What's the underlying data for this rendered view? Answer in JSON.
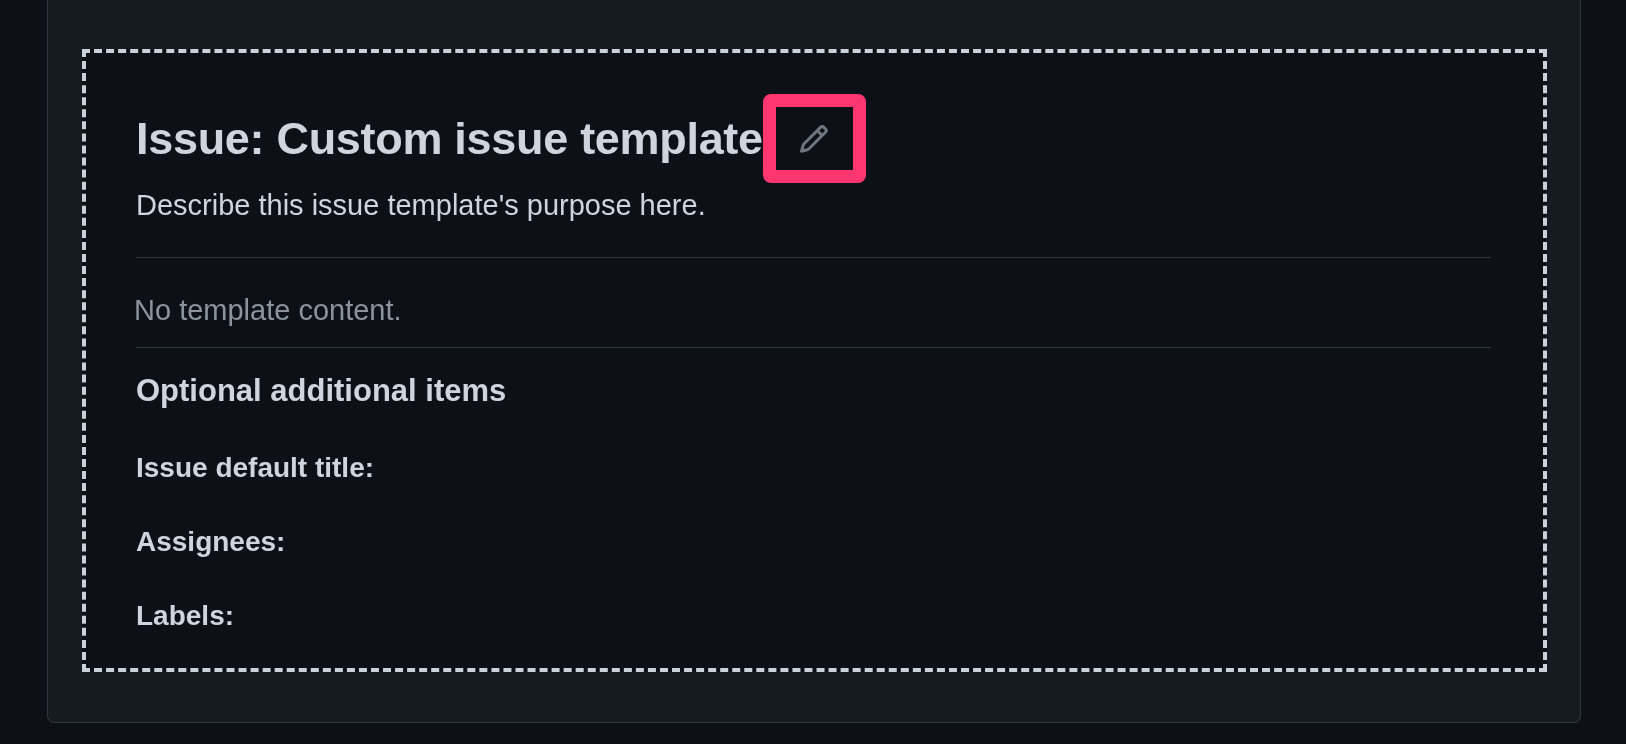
{
  "preview": {
    "title": "Issue: Custom issue template",
    "edit_button": {
      "highlighted": true
    },
    "description": "Describe this issue template's purpose here.",
    "body": "No template content.",
    "optional_section": {
      "heading": "Optional additional items",
      "fields": [
        {
          "label": "Issue default title:"
        },
        {
          "label": "Assignees:"
        },
        {
          "label": "Labels:"
        }
      ]
    }
  }
}
